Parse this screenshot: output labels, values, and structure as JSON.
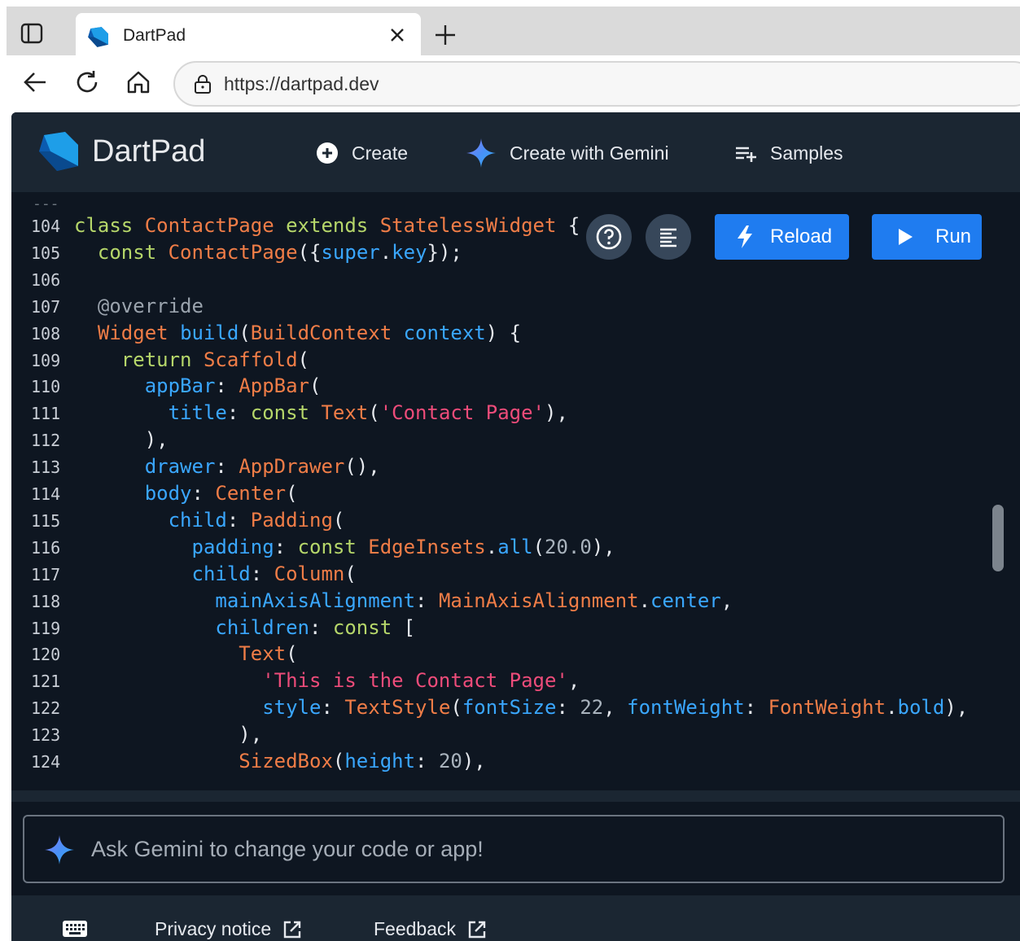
{
  "browser": {
    "tab_title": "DartPad",
    "url": "https://dartpad.dev"
  },
  "app": {
    "title": "DartPad",
    "nav": {
      "create": "Create",
      "create_gemini": "Create with Gemini",
      "samples": "Samples"
    },
    "actions": {
      "reload": "Reload",
      "run": "Run"
    },
    "gemini_prompt_placeholder": "Ask Gemini to change your code or app!",
    "footer": {
      "privacy": "Privacy notice",
      "feedback": "Feedback"
    }
  },
  "colors": {
    "background": "#0e1621",
    "header": "#1b2632",
    "accent": "#1f7cf0",
    "keyword": "#b6d76a",
    "type": "#f07d47",
    "property": "#3aa7ff",
    "string": "#ee4c7a"
  },
  "code_lines": [
    {
      "n": "104",
      "segments": [
        [
          "k",
          "class "
        ],
        [
          "t",
          "ContactPage "
        ],
        [
          "k",
          "extends "
        ],
        [
          "t",
          "StatelessWidget "
        ],
        [
          "d",
          "{"
        ]
      ]
    },
    {
      "n": "105",
      "segments": [
        [
          "d",
          "  "
        ],
        [
          "k",
          "const "
        ],
        [
          "t",
          "ContactPage"
        ],
        [
          "d",
          "({"
        ],
        [
          "p",
          "super"
        ],
        [
          "d",
          "."
        ],
        [
          "p",
          "key"
        ],
        [
          "d",
          "});"
        ]
      ]
    },
    {
      "n": "106",
      "segments": []
    },
    {
      "n": "107",
      "segments": [
        [
          "d",
          "  "
        ],
        [
          "c",
          "@override"
        ]
      ]
    },
    {
      "n": "108",
      "segments": [
        [
          "d",
          "  "
        ],
        [
          "t",
          "Widget "
        ],
        [
          "p",
          "build"
        ],
        [
          "d",
          "("
        ],
        [
          "t",
          "BuildContext "
        ],
        [
          "p",
          "context"
        ],
        [
          "d",
          ") {"
        ]
      ]
    },
    {
      "n": "109",
      "segments": [
        [
          "d",
          "    "
        ],
        [
          "k",
          "return "
        ],
        [
          "t",
          "Scaffold"
        ],
        [
          "d",
          "("
        ]
      ]
    },
    {
      "n": "110",
      "segments": [
        [
          "d",
          "      "
        ],
        [
          "p",
          "appBar"
        ],
        [
          "d",
          ": "
        ],
        [
          "t",
          "AppBar"
        ],
        [
          "d",
          "("
        ]
      ]
    },
    {
      "n": "111",
      "segments": [
        [
          "d",
          "        "
        ],
        [
          "p",
          "title"
        ],
        [
          "d",
          ": "
        ],
        [
          "k",
          "const "
        ],
        [
          "t",
          "Text"
        ],
        [
          "d",
          "("
        ],
        [
          "s",
          "'Contact Page'"
        ],
        [
          "d",
          "),"
        ]
      ]
    },
    {
      "n": "112",
      "segments": [
        [
          "d",
          "      ),"
        ]
      ]
    },
    {
      "n": "113",
      "segments": [
        [
          "d",
          "      "
        ],
        [
          "p",
          "drawer"
        ],
        [
          "d",
          ": "
        ],
        [
          "t",
          "AppDrawer"
        ],
        [
          "d",
          "(),"
        ]
      ]
    },
    {
      "n": "114",
      "segments": [
        [
          "d",
          "      "
        ],
        [
          "p",
          "body"
        ],
        [
          "d",
          ": "
        ],
        [
          "t",
          "Center"
        ],
        [
          "d",
          "("
        ]
      ]
    },
    {
      "n": "115",
      "segments": [
        [
          "d",
          "        "
        ],
        [
          "p",
          "child"
        ],
        [
          "d",
          ": "
        ],
        [
          "t",
          "Padding"
        ],
        [
          "d",
          "("
        ]
      ]
    },
    {
      "n": "116",
      "segments": [
        [
          "d",
          "          "
        ],
        [
          "p",
          "padding"
        ],
        [
          "d",
          ": "
        ],
        [
          "k",
          "const "
        ],
        [
          "t",
          "EdgeInsets"
        ],
        [
          "d",
          "."
        ],
        [
          "p",
          "all"
        ],
        [
          "d",
          "("
        ],
        [
          "n",
          "20.0"
        ],
        [
          "d",
          "),"
        ]
      ]
    },
    {
      "n": "117",
      "segments": [
        [
          "d",
          "          "
        ],
        [
          "p",
          "child"
        ],
        [
          "d",
          ": "
        ],
        [
          "t",
          "Column"
        ],
        [
          "d",
          "("
        ]
      ]
    },
    {
      "n": "118",
      "segments": [
        [
          "d",
          "            "
        ],
        [
          "p",
          "mainAxisAlignment"
        ],
        [
          "d",
          ": "
        ],
        [
          "t",
          "MainAxisAlignment"
        ],
        [
          "d",
          "."
        ],
        [
          "p",
          "center"
        ],
        [
          "d",
          ","
        ]
      ]
    },
    {
      "n": "119",
      "segments": [
        [
          "d",
          "            "
        ],
        [
          "p",
          "children"
        ],
        [
          "d",
          ": "
        ],
        [
          "k",
          "const "
        ],
        [
          "d",
          "["
        ]
      ]
    },
    {
      "n": "120",
      "segments": [
        [
          "d",
          "              "
        ],
        [
          "t",
          "Text"
        ],
        [
          "d",
          "("
        ]
      ]
    },
    {
      "n": "121",
      "segments": [
        [
          "d",
          "                "
        ],
        [
          "s",
          "'This is the Contact Page'"
        ],
        [
          "d",
          ","
        ]
      ]
    },
    {
      "n": "122",
      "segments": [
        [
          "d",
          "                "
        ],
        [
          "p",
          "style"
        ],
        [
          "d",
          ": "
        ],
        [
          "t",
          "TextStyle"
        ],
        [
          "d",
          "("
        ],
        [
          "p",
          "fontSize"
        ],
        [
          "d",
          ": "
        ],
        [
          "n",
          "22"
        ],
        [
          "d",
          ", "
        ],
        [
          "p",
          "fontWeight"
        ],
        [
          "d",
          ": "
        ],
        [
          "t",
          "FontWeight"
        ],
        [
          "d",
          "."
        ],
        [
          "p",
          "bold"
        ],
        [
          "d",
          "),"
        ]
      ]
    },
    {
      "n": "123",
      "segments": [
        [
          "d",
          "              ),"
        ]
      ]
    },
    {
      "n": "124",
      "segments": [
        [
          "d",
          "              "
        ],
        [
          "t",
          "SizedBox"
        ],
        [
          "d",
          "("
        ],
        [
          "p",
          "height"
        ],
        [
          "d",
          ": "
        ],
        [
          "n",
          "20"
        ],
        [
          "d",
          "),"
        ]
      ]
    }
  ]
}
